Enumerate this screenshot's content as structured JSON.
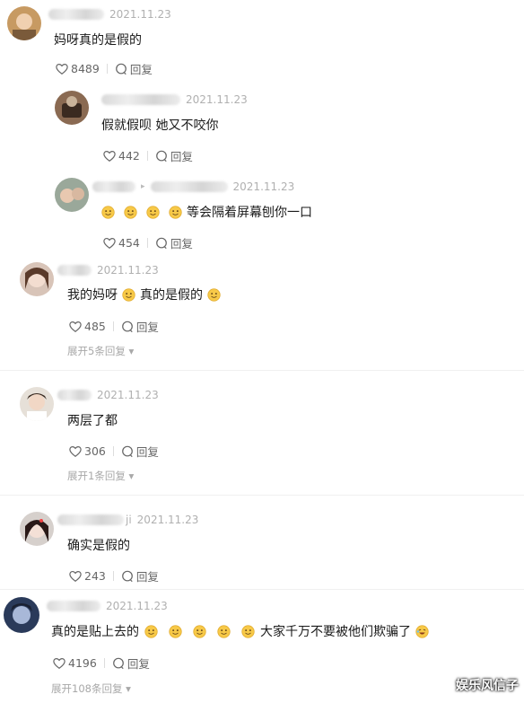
{
  "comments": [
    {
      "date": "2021.11.23",
      "text": "妈呀真的是假的",
      "likes": "8489",
      "reply_label": "回复"
    },
    {
      "date": "2021.11.23",
      "text": "假就假呗 她又不咬你",
      "likes": "442",
      "reply_label": "回复"
    },
    {
      "date": "2021.11.23",
      "text": "等会隔着屏幕刨你一口",
      "likes": "454",
      "reply_label": "回复"
    },
    {
      "date": "2021.11.23",
      "text_a": "我的妈呀",
      "text_b": "真的是假的",
      "likes": "485",
      "reply_label": "回复",
      "expand": "展开5条回复"
    },
    {
      "date": "2021.11.23",
      "text": "两层了都",
      "likes": "306",
      "reply_label": "回复",
      "expand": "展开1条回复"
    },
    {
      "date": "2021.11.23",
      "name_tail": "ji",
      "text": "确实是假的",
      "likes": "243",
      "reply_label": "回复"
    },
    {
      "date": "2021.11.23",
      "text_a": "真的是贴上去的",
      "text_b": "大家千万不要被他们欺骗了",
      "likes": "4196",
      "reply_label": "回复",
      "expand": "展开108条回复"
    }
  ],
  "watermark": "娱乐风信子",
  "colors": {
    "meta_gray": "#b0b0b0",
    "action_gray": "#666666",
    "emoji_yellow": "#f7c948"
  }
}
